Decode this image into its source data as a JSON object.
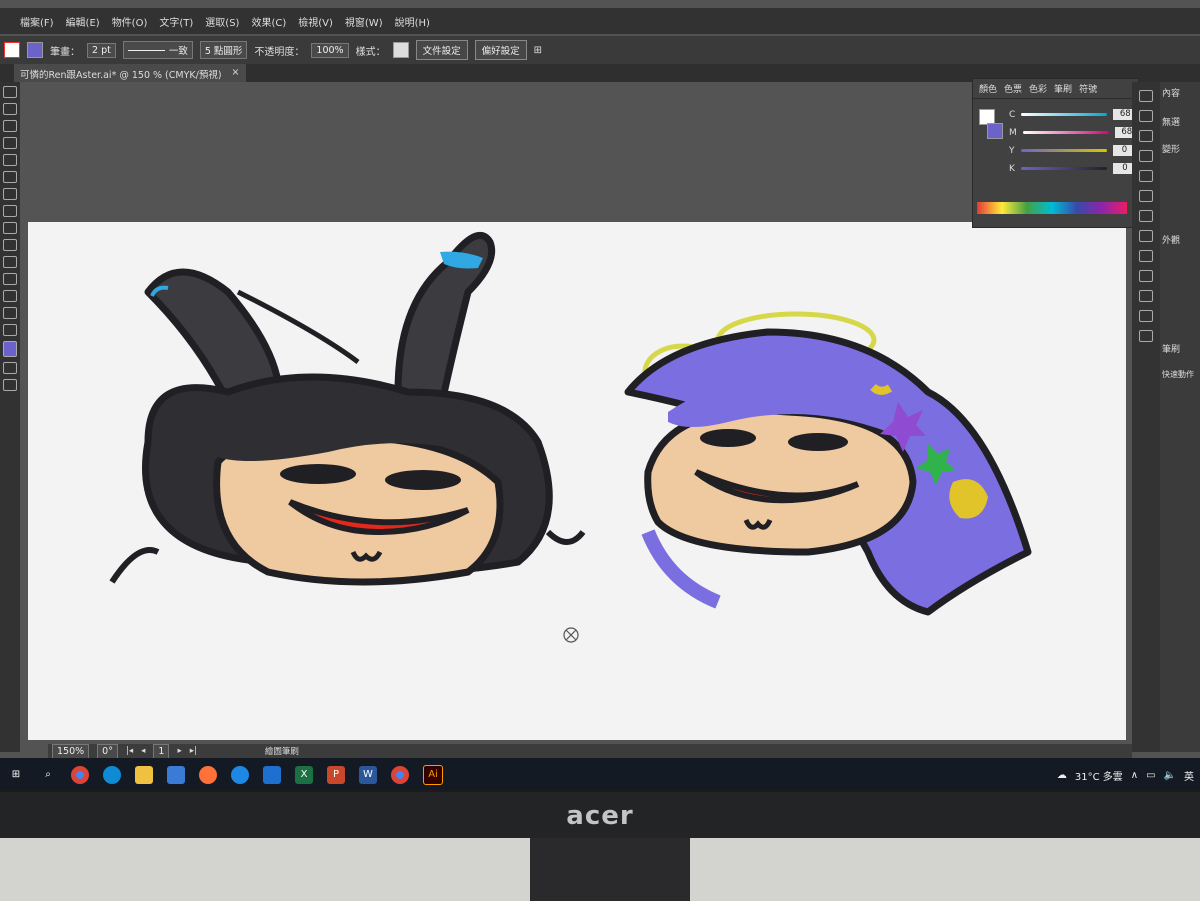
{
  "menu": [
    "檔案(F)",
    "編輯(E)",
    "物件(O)",
    "文字(T)",
    "選取(S)",
    "效果(C)",
    "檢視(V)",
    "視窗(W)",
    "說明(H)"
  ],
  "control": {
    "stroke_label": "筆畫：",
    "stroke_value": "2 pt",
    "uniform": "一致",
    "brush": "5 點圓形",
    "opacity_label": "不透明度：",
    "opacity_value": "100%",
    "style_label": "樣式：",
    "doc_setup": "文件設定",
    "prefs": "偏好設定"
  },
  "doc_tab": {
    "title": "可憐的Ren跟Aster.ai* @ 150 % (CMYK/預視)",
    "close": "×"
  },
  "color_panel": {
    "tabs": [
      "顏色",
      "色票",
      "色彩",
      "筆刷",
      "符號"
    ],
    "channels": [
      {
        "label": "C",
        "value": "68",
        "color": "#00a6d6"
      },
      {
        "label": "M",
        "value": "68",
        "color": "#d6007a"
      },
      {
        "label": "Y",
        "value": "0",
        "color": "#d6c800"
      },
      {
        "label": "K",
        "value": "0",
        "color": "#222222"
      }
    ],
    "unit": "%"
  },
  "right_panel": {
    "header": "內容",
    "labels": [
      "無選",
      "變形",
      "外觀",
      "筆刷",
      "快速動作"
    ]
  },
  "status": {
    "zoom": "150%",
    "rotation": "0°",
    "page": "1",
    "tool": "繪圖筆刷"
  },
  "taskbar": {
    "weather": "31°C 多雲",
    "lang": "英"
  },
  "monitor_brand": "acer",
  "colors": {
    "accent_fill": "#6b63c9",
    "hair_purple": "#7b6ee0",
    "skin": "#efc9a0",
    "mouth": "#e5281e"
  }
}
